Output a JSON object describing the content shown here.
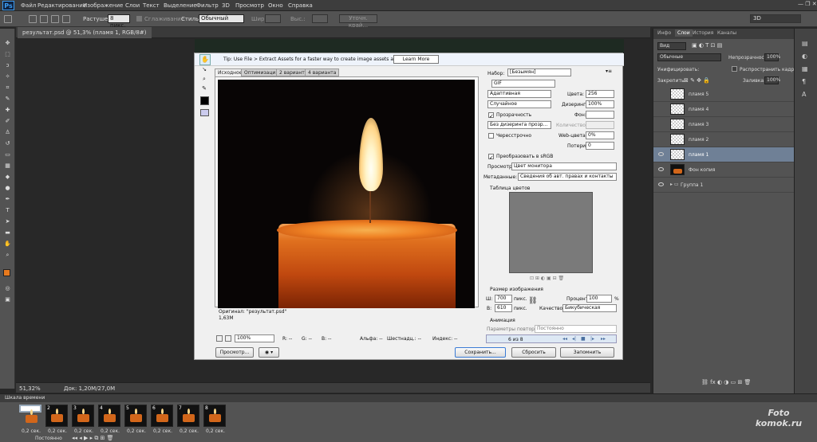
{
  "menu": {
    "logo": "Ps",
    "items": [
      "Файл",
      "Редактирование",
      "Изображение",
      "Слои",
      "Текст",
      "Выделение",
      "Фильтр",
      "3D",
      "Просмотр",
      "Окно",
      "Справка"
    ]
  },
  "options": {
    "feather_label": "Растушевка:",
    "feather_value": "8 пикс.",
    "antialias_label": "Сглаживание",
    "style_label": "Стиль:",
    "style_value": "Обычный",
    "width_label": "Шир.:",
    "height_label": "Выс.:",
    "refine_label": "Уточн. край...",
    "workspace": "3D"
  },
  "doc": {
    "tab": "результат.psd @ 51,3% (пламя 1, RGB/8#)",
    "zoom": "51,32%",
    "status": "Док: 1,20М/27,0М"
  },
  "dialog": {
    "tip": "Tip: Use File > Extract Assets for a faster way to create image assets and SVG",
    "learn_more": "Learn More",
    "tabs": [
      "Исходное",
      "Оптимизация",
      "2 варианта",
      "4 варианта"
    ],
    "original_label": "Оригинал: \"результат.psd\"",
    "original_size": "1,63M",
    "zoom": "100%",
    "readouts": {
      "r": "R: --",
      "g": "G: --",
      "b": "B: --",
      "alpha": "Альфа: --",
      "hex": "Шестнадц.: --",
      "index": "Индекс: --"
    },
    "preview_btn": "Просмотр...",
    "save_btn": "Сохранить...",
    "reset_btn": "Сбросить",
    "remember_btn": "Запомнить",
    "preset_label": "Набор:",
    "preset_value": "[Безымян]",
    "format": "GIF",
    "reduction": "Адаптивная",
    "colors_label": "Цвета:",
    "colors_value": "256",
    "dither_method": "Случайное",
    "dither_label": "Дизеринг:",
    "dither_value": "100%",
    "transparency": "Прозрачность",
    "matte_label": "Фон:",
    "transp_dither": "Без дизеринга прозр...",
    "amount_label": "Количество:",
    "interlaced": "Чересстрочно",
    "websnap_label": "Web-цвета:",
    "websnap_value": "0%",
    "lossy_label": "Потери:",
    "lossy_value": "0",
    "convert_srgb": "Преобразовать в sRGB",
    "preview_mode_label": "Просмотр:",
    "preview_mode_value": "Цвет монитора",
    "metadata_label": "Метаданные:",
    "metadata_value": "Сведения об авт. правах и контакты",
    "color_table_label": "Таблица цветов",
    "image_size_label": "Размер изображения",
    "w_label": "Ш:",
    "w_value": "700",
    "h_label": "В:",
    "h_value": "610",
    "px": "пикс.",
    "percent_label": "Процентов:",
    "percent_value": "100",
    "percent_unit": "%",
    "quality_label": "Качество:",
    "quality_value": "Бикубическая",
    "animation_label": "Анимация",
    "loop_label": "Параметры повторов:",
    "loop_value": "Постоянно",
    "frame_counter": "6 из 8"
  },
  "timeline": {
    "title": "Шкала времени",
    "frames": [
      "1",
      "2",
      "3",
      "4",
      "5",
      "6",
      "7",
      "8"
    ],
    "delay": "0,2 сек.",
    "loop": "Постоянно"
  },
  "panels": {
    "tabs": [
      "Инфо",
      "Слои",
      "История",
      "Каналы"
    ],
    "kind": "Вид",
    "blend": "Обычные",
    "opacity_label": "Непрозрачность:",
    "opacity_value": "100%",
    "unify_label": "Унифицировать:",
    "propagate": "Распространить кадр 1",
    "lock_label": "Закрепить:",
    "fill_label": "Заливка:",
    "fill_value": "100%",
    "layers": [
      "пламя 5",
      "пламя 4",
      "пламя 3",
      "пламя 2",
      "пламя 1",
      "Фон копия",
      "Группа 1"
    ]
  },
  "watermark": {
    "line1": "Foto",
    "line2": "komok.ru"
  }
}
